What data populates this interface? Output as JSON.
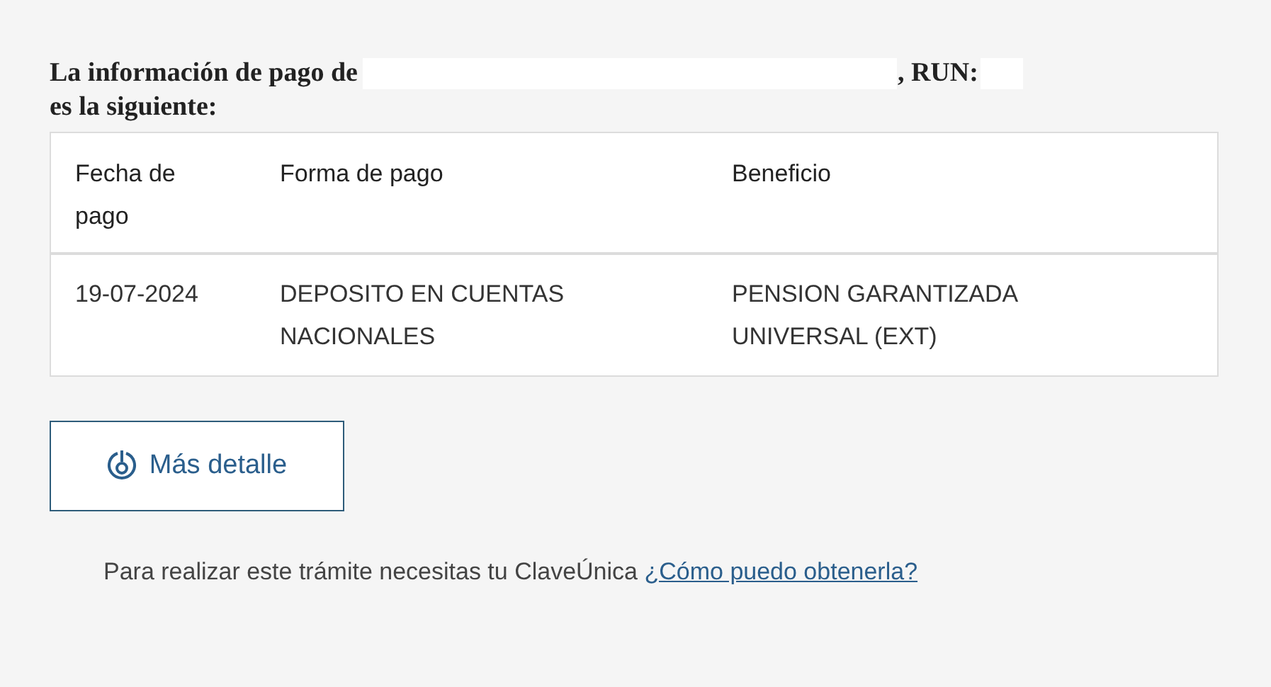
{
  "heading": {
    "lead": "La información de pago de",
    "run_label": ", RUN:",
    "trail": "es la siguiente:"
  },
  "table": {
    "columns": [
      "Fecha de pago",
      "Forma de pago",
      "Beneficio"
    ],
    "rows": [
      [
        "19-07-2024",
        "DEPOSITO EN CUENTAS NACIONALES",
        "PENSION GARANTIZADA UNIVERSAL (EXT)"
      ]
    ]
  },
  "detail_button": {
    "label": "Más detalle"
  },
  "footer": {
    "text": "Para realizar este trámite necesitas tu ClaveÚnica",
    "link": "¿Cómo puedo obtenerla?"
  }
}
